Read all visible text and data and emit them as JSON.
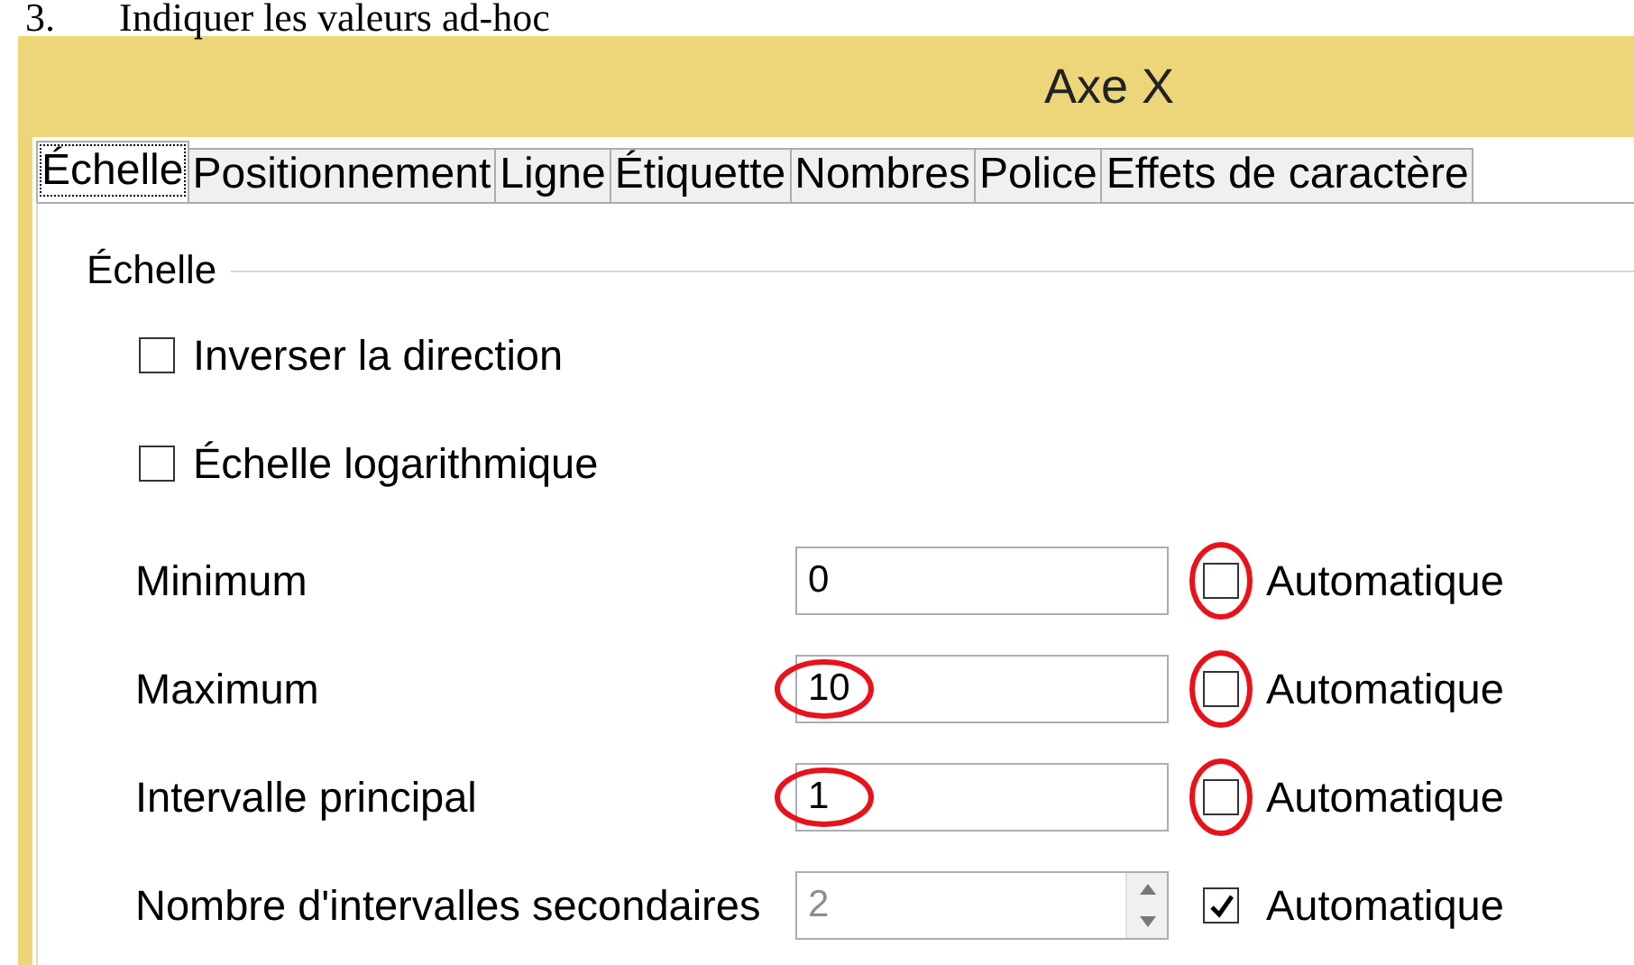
{
  "document": {
    "number": "3.",
    "text": "Indiquer les valeurs ad-hoc"
  },
  "window": {
    "title": "Axe X"
  },
  "tabs": [
    {
      "label": "Échelle",
      "selected": true
    },
    {
      "label": "Positionnement",
      "selected": false
    },
    {
      "label": "Ligne",
      "selected": false
    },
    {
      "label": "Étiquette",
      "selected": false
    },
    {
      "label": "Nombres",
      "selected": false
    },
    {
      "label": "Police",
      "selected": false
    },
    {
      "label": "Effets de caractère",
      "selected": false
    }
  ],
  "group": {
    "title": "Échelle"
  },
  "options": [
    {
      "label": "Inverser la direction",
      "checked": false
    },
    {
      "label": "Échelle logarithmique",
      "checked": false
    }
  ],
  "fields": [
    {
      "kind": "text",
      "label": "Minimum",
      "value": "0",
      "disabled": false,
      "automatic": {
        "label": "Automatique",
        "checked": false,
        "circled": true
      }
    },
    {
      "kind": "text",
      "label": "Maximum",
      "value": "10",
      "disabled": false,
      "value_circled": true,
      "automatic": {
        "label": "Automatique",
        "checked": false,
        "circled": true
      }
    },
    {
      "kind": "text",
      "label": "Intervalle principal",
      "value": "1",
      "disabled": false,
      "value_circled": true,
      "automatic": {
        "label": "Automatique",
        "checked": false,
        "circled": true
      }
    },
    {
      "kind": "spin",
      "label": "Nombre d'intervalles secondaires",
      "value": "2",
      "disabled": true,
      "automatic": {
        "label": "Automatique",
        "checked": true
      }
    }
  ]
}
